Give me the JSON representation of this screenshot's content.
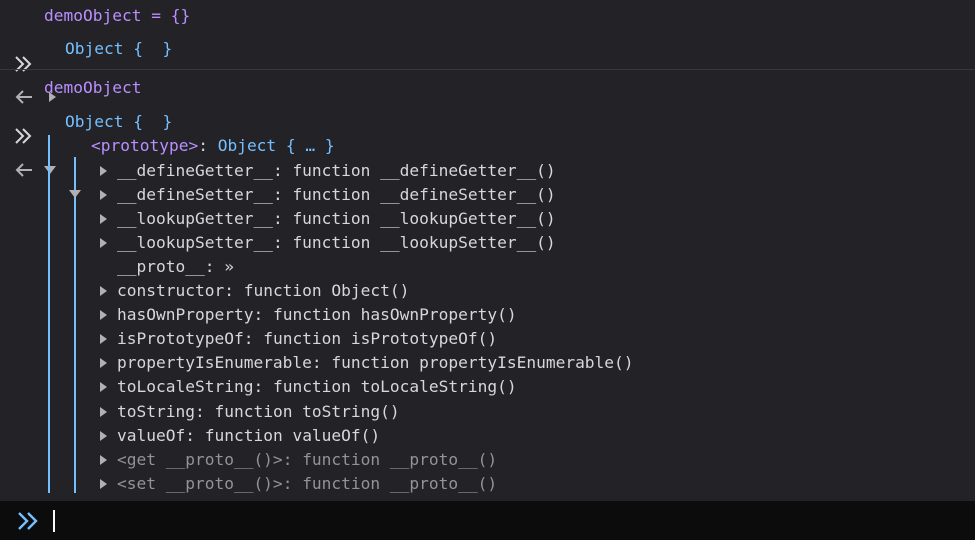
{
  "history": [
    {
      "type": "input",
      "text": "demoObject = {}"
    },
    {
      "type": "output",
      "text": "Object {  }",
      "expanded": false
    },
    {
      "type": "input",
      "text": "demoObject"
    },
    {
      "type": "output",
      "text": "Object {  }",
      "expanded": true
    }
  ],
  "tree": {
    "prototype": {
      "key": "<prototype>",
      "sep": ": ",
      "value": "Object { … }"
    },
    "members": [
      {
        "key": "__defineGetter__",
        "value": "function __defineGetter__()",
        "expandable": true,
        "dim": false
      },
      {
        "key": "__defineSetter__",
        "value": "function __defineSetter__()",
        "expandable": true,
        "dim": false
      },
      {
        "key": "__lookupGetter__",
        "value": "function __lookupGetter__()",
        "expandable": true,
        "dim": false
      },
      {
        "key": "__lookupSetter__",
        "value": "function __lookupSetter__()",
        "expandable": true,
        "dim": false
      },
      {
        "key": "__proto__",
        "value": "»",
        "expandable": false,
        "dim": false
      },
      {
        "key": "constructor",
        "value": "function Object()",
        "expandable": true,
        "dim": false
      },
      {
        "key": "hasOwnProperty",
        "value": "function hasOwnProperty()",
        "expandable": true,
        "dim": false
      },
      {
        "key": "isPrototypeOf",
        "value": "function isPrototypeOf()",
        "expandable": true,
        "dim": false
      },
      {
        "key": "propertyIsEnumerable",
        "value": "function propertyIsEnumerable()",
        "expandable": true,
        "dim": false
      },
      {
        "key": "toLocaleString",
        "value": "function toLocaleString()",
        "expandable": true,
        "dim": false
      },
      {
        "key": "toString",
        "value": "function toString()",
        "expandable": true,
        "dim": false
      },
      {
        "key": "valueOf",
        "value": "function valueOf()",
        "expandable": true,
        "dim": false
      },
      {
        "key": "<get __proto__()>",
        "value": "function __proto__()",
        "expandable": true,
        "dim": true
      },
      {
        "key": "<set __proto__()>",
        "value": "function __proto__()",
        "expandable": true,
        "dim": true
      }
    ]
  },
  "input_line": {
    "value": ""
  },
  "colors": {
    "background": "#232327",
    "input_bar": "#0c0c0d",
    "prompt": "#75bfff",
    "command_text": "#b98eff",
    "object_text": "#75bfff",
    "key_text": "#d7d7db",
    "dim_text": "#939395",
    "tree_guide": "#75bfff"
  },
  "icons": {
    "input_prompt": "double-chevron-right-icon",
    "output_arrow": "arrow-left-icon",
    "collapsed": "triangle-right-icon",
    "expanded": "triangle-down-icon"
  }
}
